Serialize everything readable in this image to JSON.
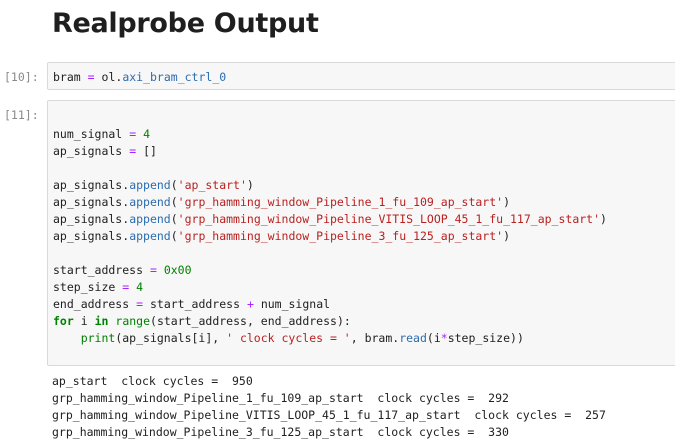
{
  "heading": "Realprobe Output",
  "cells": [
    {
      "prompt": "[10]:",
      "code": {
        "lhs": "bram",
        "op": "=",
        "obj": "ol",
        "attr": "axi_bram_ctrl_0"
      }
    },
    {
      "prompt": "[11]:",
      "code": {
        "num_signal": {
          "name": "num_signal",
          "op": "=",
          "value": "4"
        },
        "ap_signals_init": {
          "name": "ap_signals",
          "op": "=",
          "value": "[]"
        },
        "appends": [
          {
            "target": "ap_signals",
            "method": "append",
            "arg": "'ap_start'"
          },
          {
            "target": "ap_signals",
            "method": "append",
            "arg": "'grp_hamming_window_Pipeline_1_fu_109_ap_start'"
          },
          {
            "target": "ap_signals",
            "method": "append",
            "arg": "'grp_hamming_window_Pipeline_VITIS_LOOP_45_1_fu_117_ap_start'"
          },
          {
            "target": "ap_signals",
            "method": "append",
            "arg": "'grp_hamming_window_Pipeline_3_fu_125_ap_start'"
          }
        ],
        "start_address": {
          "name": "start_address",
          "op": "=",
          "value": "0x00"
        },
        "step_size": {
          "name": "step_size",
          "op": "=",
          "value": "4"
        },
        "end_address": {
          "lhs": "end_address",
          "op": "=",
          "a": "start_address",
          "plus": "+",
          "b": "num_signal"
        },
        "for_line": {
          "kw_for": "for",
          "var": "i",
          "kw_in": "in",
          "fn": "range",
          "args": "(start_address, end_address):"
        },
        "print_line": {
          "fn": "print",
          "pre": "(ap_signals[i], ",
          "str": "' clock cycles = '",
          "mid": ", bram.",
          "method": "read",
          "arg_a": "(i",
          "star": "*",
          "arg_b": "step_size))"
        }
      }
    }
  ],
  "output_lines": [
    "ap_start  clock cycles =  950",
    "grp_hamming_window_Pipeline_1_fu_109_ap_start  clock cycles =  292",
    "grp_hamming_window_Pipeline_VITIS_LOOP_45_1_fu_117_ap_start  clock cycles =  257",
    "grp_hamming_window_Pipeline_3_fu_125_ap_start  clock cycles =  330"
  ],
  "colors": {
    "keyword": "#008000",
    "string": "#ba2121",
    "operator": "#aa22ff",
    "attribute": "#2b6cb0",
    "prompt": "#8a8a8a",
    "cell_bg": "#f7f7f7"
  }
}
